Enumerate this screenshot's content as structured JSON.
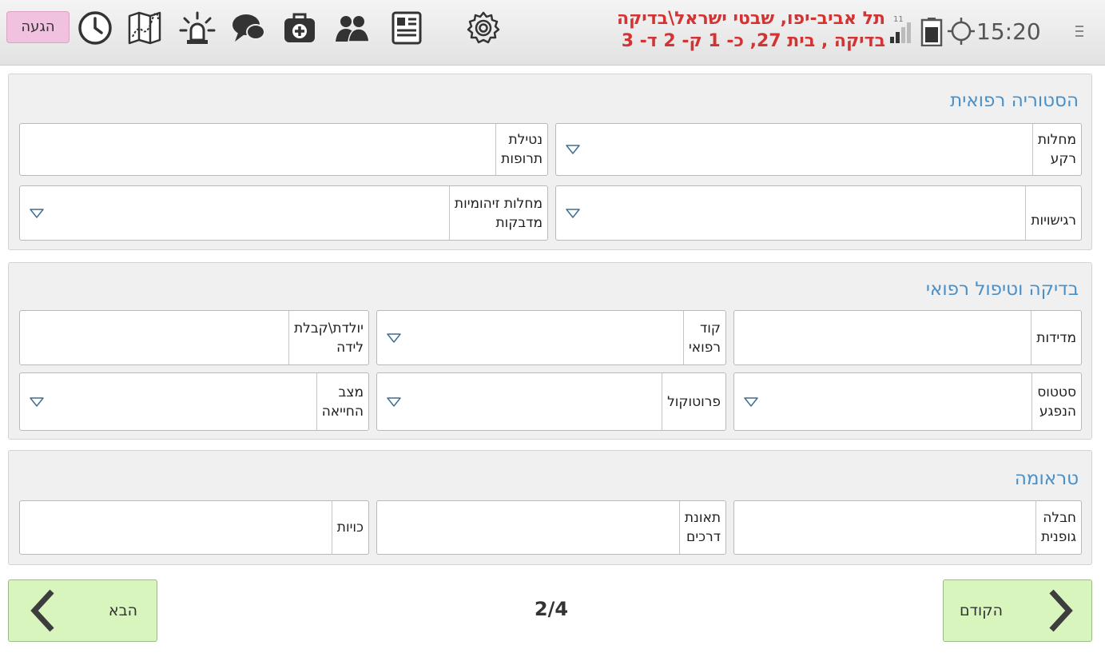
{
  "topbar": {
    "arrive_label": "הגעה",
    "address_line1": "תל אביב-יפו, שבטי ישראל\\בדיקה",
    "address_line2": "בדיקה ,  בית 27,  כ- 1 ק- 2 ד- 3",
    "signal_badge": "11",
    "clock": "15:20",
    "icons": [
      "clock-icon",
      "map-icon",
      "siren-icon",
      "chat-icon",
      "medkit-icon",
      "team-icon",
      "form-icon",
      "settings-icon"
    ],
    "address_color": "#d23434"
  },
  "sections": {
    "medical_history": {
      "title": "הסטוריה רפואית",
      "background_diseases": [
        "מחלות",
        "רקע"
      ],
      "medications": [
        "נטילת",
        "תרופות"
      ],
      "allergies": [
        "רגישויות"
      ],
      "infectious_diseases": [
        "מחלות זיהומיות",
        "מדבקות"
      ]
    },
    "exam": {
      "title": "בדיקה וטיפול רפואי",
      "measurements": [
        "מדידות"
      ],
      "medical_code": [
        "קוד",
        "רפואי"
      ],
      "birth": [
        "יולדת\\קבלת",
        "לידה"
      ],
      "patient_status": [
        "סטטוס",
        "הנפגע"
      ],
      "protocol": [
        "פרוטוקול"
      ],
      "resuscitation": [
        "מצב",
        "החייאה"
      ]
    },
    "trauma": {
      "title": "טראומה",
      "bodily_injury": [
        "חבלה",
        "גופנית"
      ],
      "road_accident": [
        "תאונת",
        "דרכים"
      ],
      "burns": [
        "כויות"
      ]
    }
  },
  "footer": {
    "next_label": "הבא",
    "prev_label": "הקודם",
    "page_indicator": "2/4"
  },
  "colors": {
    "accent_title": "#4a90c8",
    "arrive_button": "#f0c2df",
    "nav_button": "#d7f5bd"
  }
}
